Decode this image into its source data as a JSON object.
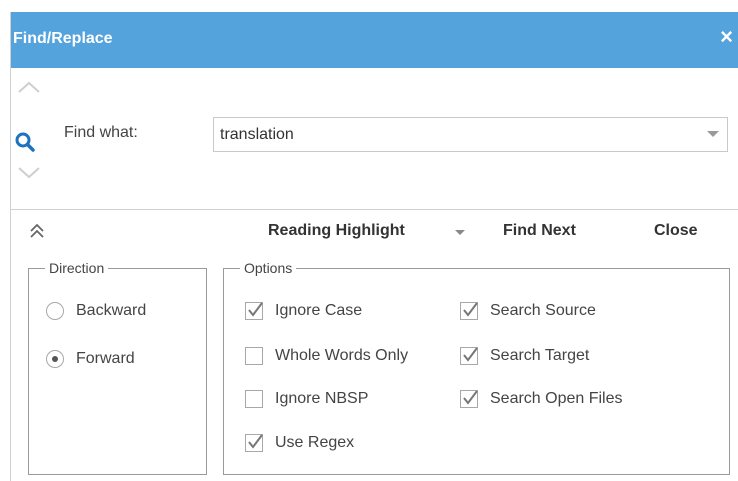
{
  "window": {
    "title": "Find/Replace",
    "close_glyph": "×"
  },
  "find": {
    "label": "Find what:",
    "value": "translation"
  },
  "toolbar": {
    "reading_highlight_label": "Reading Highlight",
    "find_next_label": "Find Next",
    "close_label": "Close"
  },
  "direction": {
    "legend": "Direction",
    "options": [
      {
        "label": "Backward",
        "selected": false
      },
      {
        "label": "Forward",
        "selected": true
      }
    ]
  },
  "options": {
    "legend": "Options",
    "items": [
      {
        "label": "Ignore Case",
        "checked": true
      },
      {
        "label": "Whole Words Only",
        "checked": false
      },
      {
        "label": "Ignore NBSP",
        "checked": false
      },
      {
        "label": "Use Regex",
        "checked": true
      },
      {
        "label": "Search Source",
        "checked": true
      },
      {
        "label": "Search Target",
        "checked": true
      },
      {
        "label": "Search Open Files",
        "checked": true
      }
    ]
  },
  "colors": {
    "titlebar": "#55a3dd",
    "accent_icon": "#1e73be"
  },
  "icons": {
    "search": "search-icon",
    "collapse": "double-chevron-up-icon",
    "previous": "chevron-up-icon",
    "next": "chevron-down-icon"
  }
}
